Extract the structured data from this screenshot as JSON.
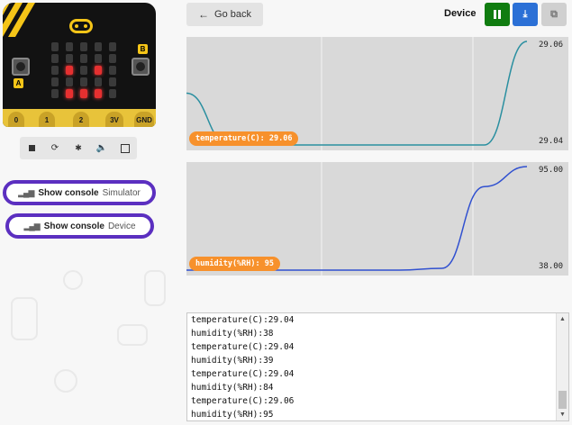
{
  "simulator": {
    "pins": [
      "0",
      "1",
      "2",
      "3V",
      "GND"
    ],
    "button_a": "A",
    "button_b": "B",
    "leds": [
      [
        0,
        0,
        0,
        0,
        0
      ],
      [
        0,
        0,
        0,
        0,
        0
      ],
      [
        0,
        1,
        0,
        1,
        0
      ],
      [
        0,
        0,
        0,
        0,
        0
      ],
      [
        0,
        1,
        1,
        1,
        0
      ]
    ],
    "controls": [
      "stop-icon",
      "restart-icon",
      "debug-icon",
      "mute-icon",
      "fullscreen-icon"
    ]
  },
  "console_buttons": [
    {
      "label": "Show console",
      "target": "Simulator"
    },
    {
      "label": "Show console",
      "target": "Device"
    }
  ],
  "topbar": {
    "go_back": "Go back",
    "device": "Device",
    "colors": {
      "pause": "#107c10",
      "download": "#2b70d6",
      "copy": "#d0d0d0"
    }
  },
  "chart_data": [
    {
      "type": "line",
      "title": "",
      "series": [
        {
          "name": "temperature(C)",
          "values": [
            29.05,
            29.04,
            29.04,
            29.04,
            29.04,
            29.04,
            29.04,
            29.04,
            29.06
          ]
        }
      ],
      "ylim": [
        29.04,
        29.06
      ],
      "max_label": "29.06",
      "min_label": "29.04",
      "current_label": "temperature(C): 29.06",
      "color": "#2a8fa0"
    },
    {
      "type": "line",
      "title": "",
      "series": [
        {
          "name": "humidity(%RH)",
          "values": [
            38,
            38,
            38,
            38,
            38,
            38,
            39,
            84,
            95
          ]
        }
      ],
      "ylim": [
        38,
        95
      ],
      "max_label": "95.00",
      "min_label": "38.00",
      "current_label": "humidity(%RH): 95",
      "color": "#3050d0"
    }
  ],
  "console_output": [
    "temperature(C):29.04",
    "humidity(%RH):38",
    "temperature(C):29.04",
    "humidity(%RH):39",
    "temperature(C):29.04",
    "humidity(%RH):84",
    "temperature(C):29.06",
    "humidity(%RH):95"
  ]
}
